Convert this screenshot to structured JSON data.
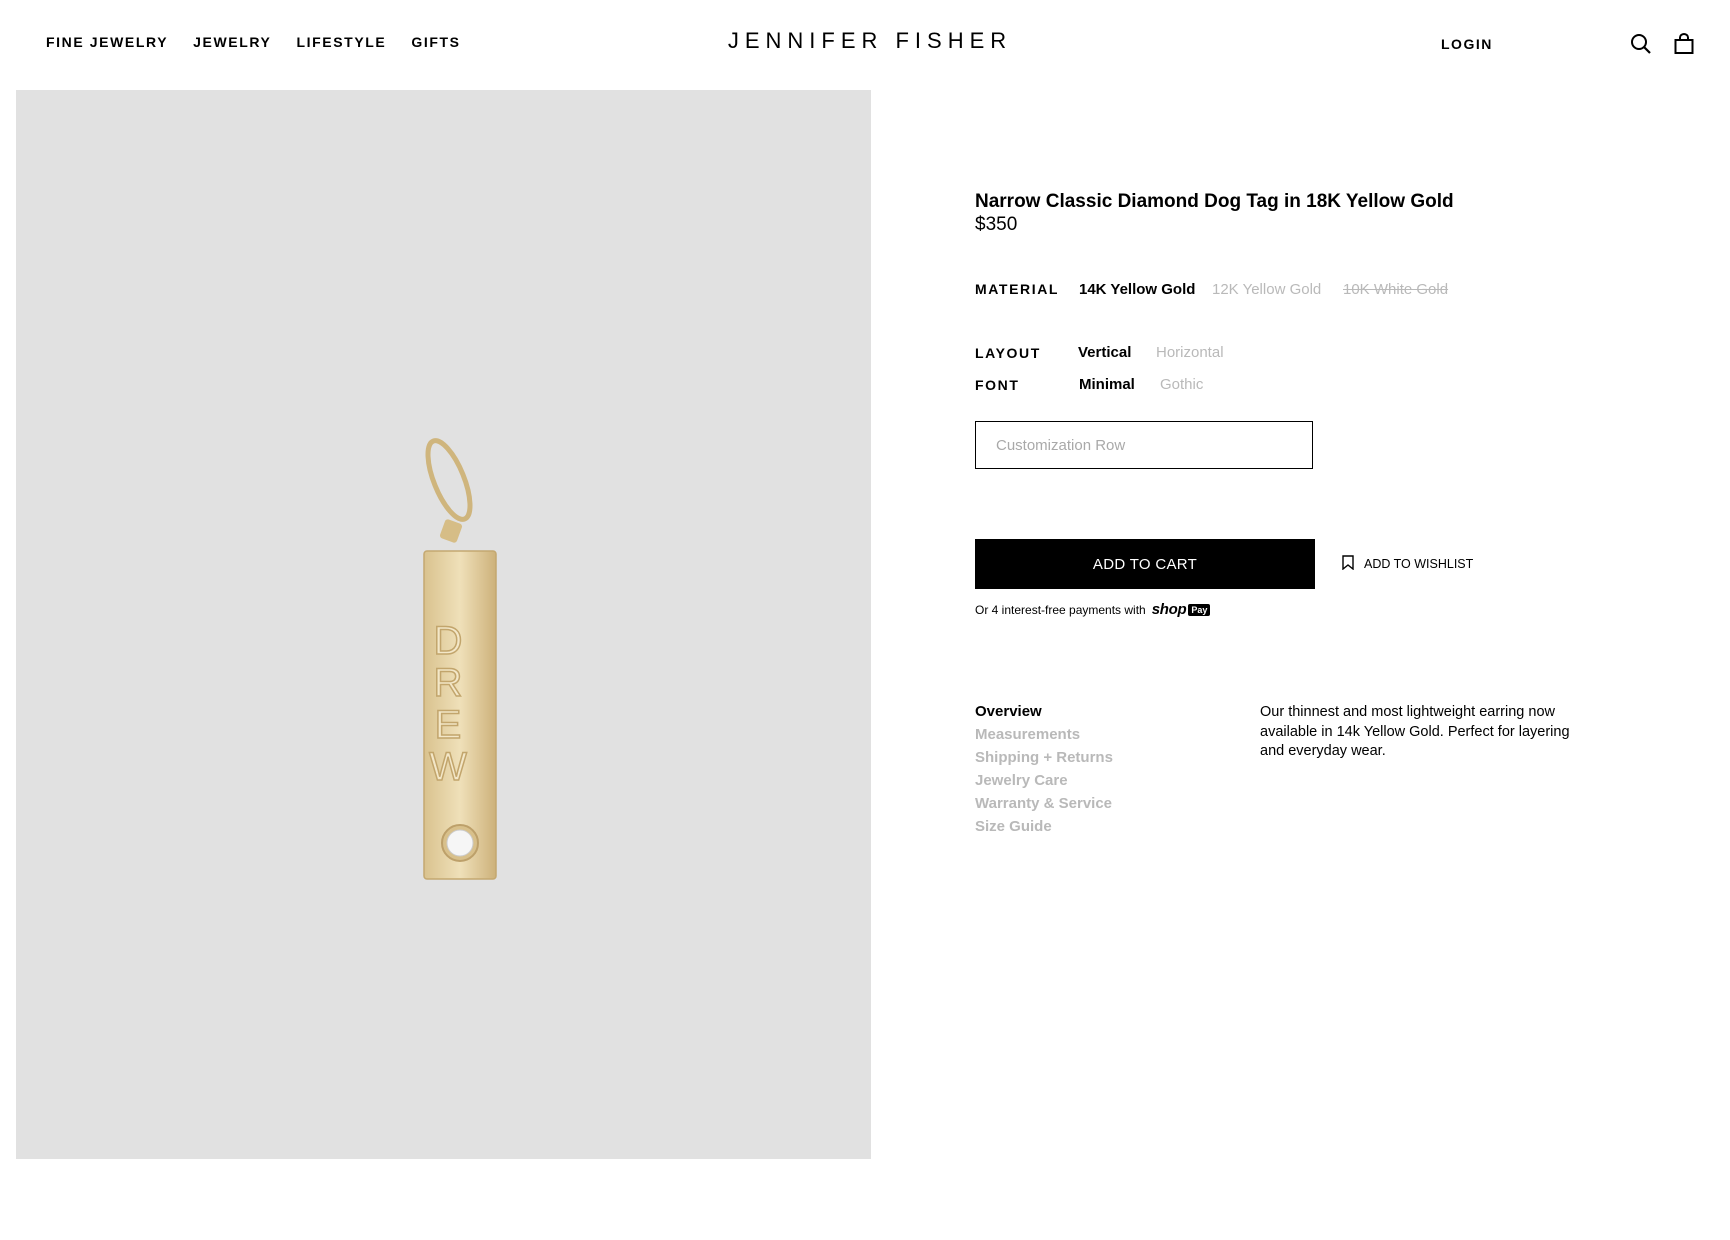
{
  "header": {
    "nav": [
      "FINE JEWELRY",
      "JEWELRY",
      "LIFESTYLE",
      "GIFTS"
    ],
    "brand": "JENNIFER FISHER",
    "login": "LOGIN",
    "icons": [
      "search-icon",
      "bag-icon"
    ]
  },
  "product": {
    "title": "Narrow Classic Diamond Dog Tag in 18K Yellow Gold",
    "price": "$350",
    "engraving": "DREW",
    "material": {
      "label": "MATERIAL",
      "options": [
        "14K Yellow Gold",
        "12K Yellow Gold",
        "10K White Gold"
      ],
      "selected": "14K Yellow Gold"
    },
    "layout": {
      "label": "LAYOUT",
      "options": [
        "Vertical",
        "Horizontal"
      ],
      "selected": "Vertical"
    },
    "font": {
      "label": "FONT",
      "options": [
        "Minimal",
        "Gothic"
      ],
      "selected": "Minimal"
    },
    "customization_placeholder": "Customization Row",
    "add_to_cart": "ADD TO CART",
    "add_to_wishlist": "ADD TO WISHLIST",
    "installments": "Or 4 interest-free payments with",
    "shoppay": {
      "shop": "shop",
      "pay": "Pay"
    }
  },
  "details": {
    "tabs": [
      "Overview",
      "Measurements",
      "Shipping + Returns",
      "Jewelry Care",
      "Warranty & Service",
      "Size Guide"
    ],
    "active_tab": "Overview",
    "overview_text": "Our thinnest and most lightweight earring now available in 14k Yellow Gold. Perfect for layering and everyday wear."
  },
  "colors": {
    "image_bg": "#e1e1e1",
    "muted_text": "#b9b9b9",
    "gold": "#e6d2a4"
  }
}
